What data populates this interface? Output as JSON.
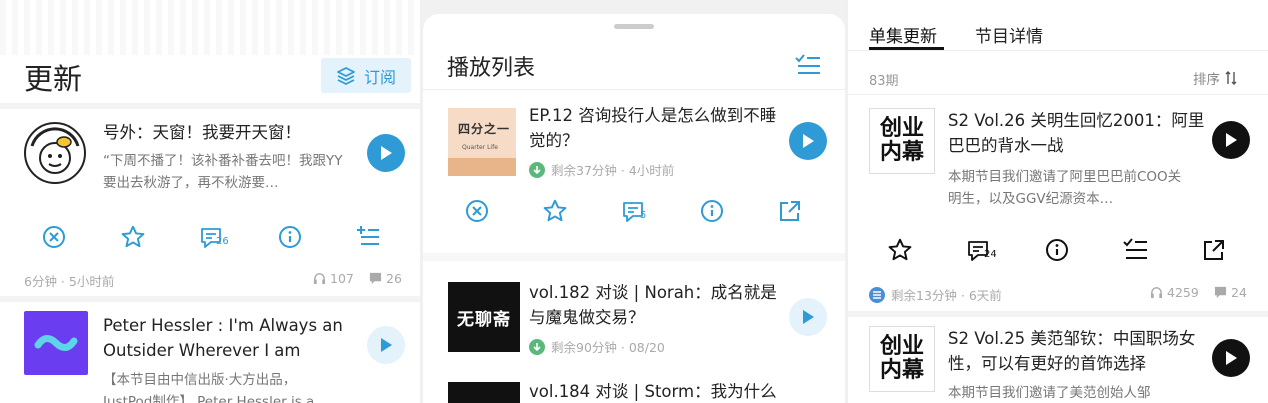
{
  "left": {
    "header_title": "更新",
    "subscribe_label": "订阅",
    "episode1": {
      "title": "号外：天窗！我要开天窗！",
      "desc": "“下周不播了！该补番补番去吧！我跟YY要出去秋游了，再不秋游要…",
      "comment_badge": "26",
      "duration_time": "6分钟 · 5小时前",
      "listens": "107",
      "comments": "26"
    },
    "episode2": {
      "title": "Peter Hessler : I'm Always an Outsider Wherever I am",
      "desc": "【本节目由中信出版·大方出品，JustPod制作】 Peter Hessler is a"
    }
  },
  "middle": {
    "header_title": "播放列表",
    "items": [
      {
        "title": "EP.12 咨询投行人是怎么做到不睡觉的？",
        "meta": "剩余37分钟 · 4小时前",
        "cover_text": "四分之一",
        "cover_sub": "Quarter Life"
      },
      {
        "title": "vol.182 对谈 | Norah：成名就是与魔鬼做交易？",
        "meta": "剩余90分钟 · 08/20",
        "cover_text": "无聊斋"
      },
      {
        "title": "vol.184 对谈 | Storm：我为什么"
      }
    ],
    "comment_badge": "5"
  },
  "right": {
    "tabs": [
      "单集更新",
      "节目详情"
    ],
    "count": "83期",
    "sort_label": "排序",
    "cover_text": "创业内幕",
    "episodes": [
      {
        "title": "S2 Vol.26 关明生回忆2001：阿里巴巴的背水一战",
        "desc": "本期节目我们邀请了阿里巴巴前COO关明生，以及GGV纪源资本…",
        "comment_badge": "24",
        "meta": "剩余13分钟 · 6天前",
        "listens": "4259",
        "comments": "24"
      },
      {
        "title": "S2 Vol.25 美范邹钦：中国职场女性，可以有更好的首饰选择",
        "desc": "本期节目我们邀请了美范创始人邹"
      }
    ]
  },
  "colors": {
    "accent": "#2e9bd6",
    "accent_light": "#e3f2fb",
    "green": "#5bb87a",
    "dark": "#111111"
  }
}
